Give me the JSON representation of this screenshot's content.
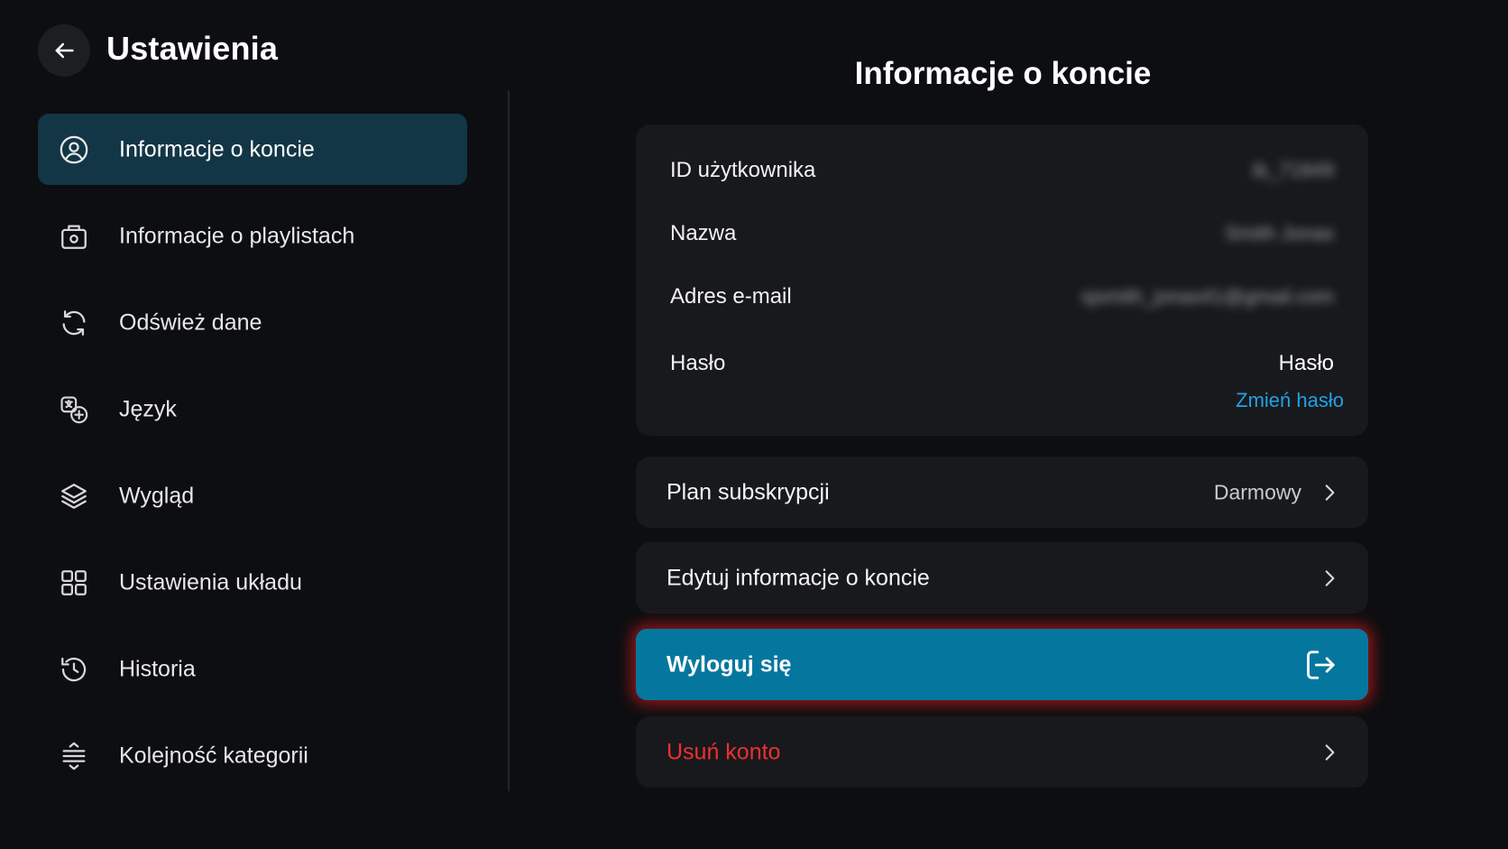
{
  "header": {
    "title": "Ustawienia",
    "back_icon": "arrow-left-icon"
  },
  "sidebar": {
    "items": [
      {
        "label": "Informacje o koncie",
        "icon": "user-circle-icon",
        "active": true
      },
      {
        "label": "Informacje o playlistach",
        "icon": "playlist-box-icon",
        "active": false
      },
      {
        "label": "Odśwież dane",
        "icon": "refresh-icon",
        "active": false
      },
      {
        "label": "Język",
        "icon": "language-icon",
        "active": false
      },
      {
        "label": "Wygląd",
        "icon": "layers-icon",
        "active": false
      },
      {
        "label": "Ustawienia układu",
        "icon": "grid-layout-icon",
        "active": false
      },
      {
        "label": "Historia",
        "icon": "history-icon",
        "active": false
      },
      {
        "label": "Kolejność kategorii",
        "icon": "sort-order-icon",
        "active": false
      }
    ]
  },
  "main": {
    "title": "Informacje o koncie",
    "account": {
      "user_id_label": "ID użytkownika",
      "user_id_value": "ib_71849",
      "name_label": "Nazwa",
      "name_value": "Smith Jonas",
      "email_label": "Adres e-mail",
      "email_value": "sjsmith_jonas41@gmail.com",
      "password_label": "Hasło",
      "password_value": "Hasło",
      "change_password_link": "Zmień hasło"
    },
    "subscription": {
      "label": "Plan subskrypcji",
      "value": "Darmowy"
    },
    "edit_account": {
      "label": "Edytuj informacje o koncie"
    },
    "logout": {
      "label": "Wyloguj się",
      "icon": "logout-icon"
    },
    "delete_account": {
      "label": "Usuń konto"
    }
  },
  "colors": {
    "background": "#0d0e11",
    "card": "#18191c",
    "active_sidebar": "#123645",
    "accent_blue": "#05779f",
    "link_blue": "#1fa3e6",
    "danger_red": "#ef2f2f"
  }
}
